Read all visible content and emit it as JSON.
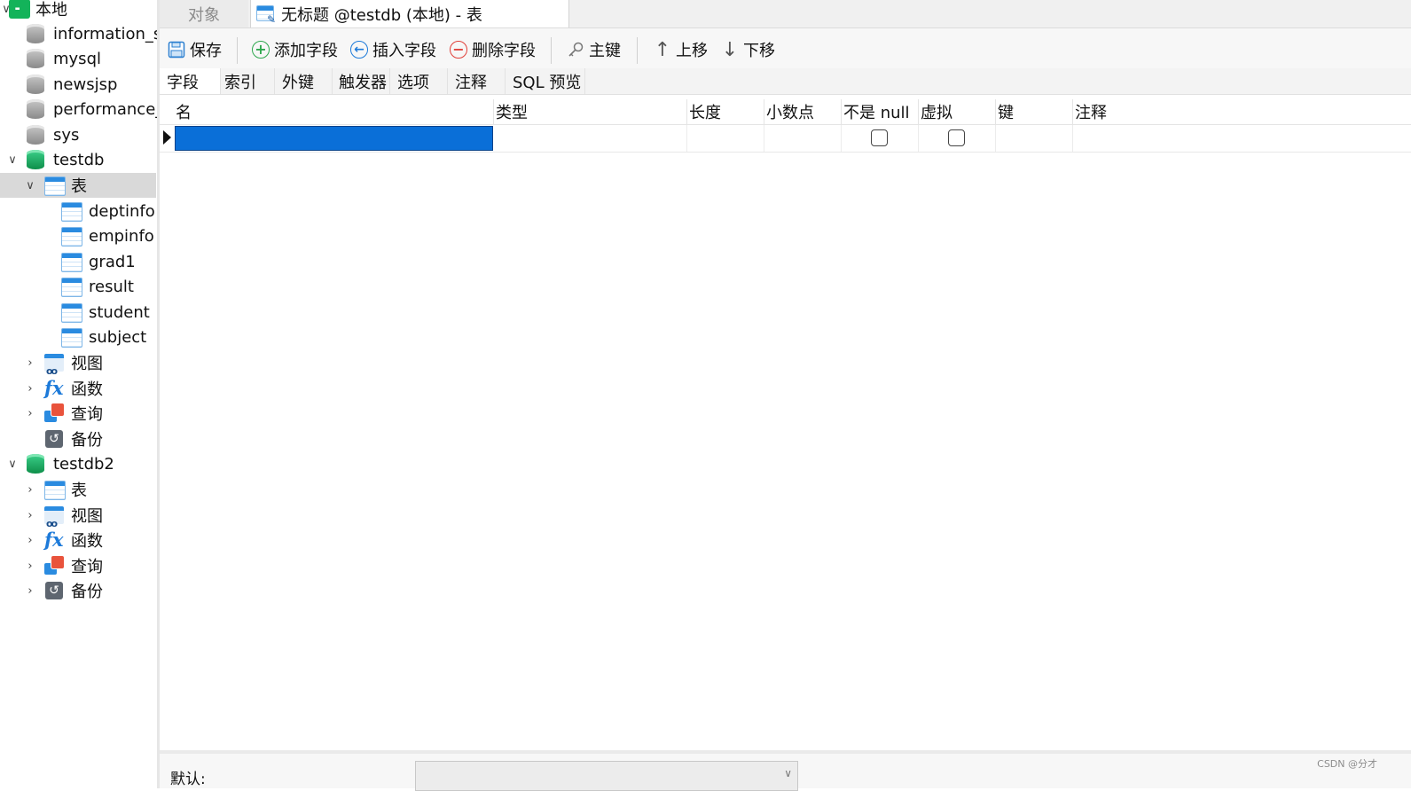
{
  "sidebar": {
    "items": [
      {
        "label": "本地",
        "icon": "connection-icon"
      },
      {
        "label": "information_s",
        "icon": "database-icon"
      },
      {
        "label": "mysql",
        "icon": "database-icon"
      },
      {
        "label": "newsjsp",
        "icon": "database-icon"
      },
      {
        "label": "performance_",
        "icon": "database-icon"
      },
      {
        "label": "sys",
        "icon": "database-icon"
      },
      {
        "label": "testdb",
        "icon": "database-open-icon"
      },
      {
        "label": "表",
        "icon": "table-folder-icon"
      },
      {
        "label": "deptinfo",
        "icon": "table-icon"
      },
      {
        "label": "empinfo",
        "icon": "table-icon"
      },
      {
        "label": "grad1",
        "icon": "table-icon"
      },
      {
        "label": "result",
        "icon": "table-icon"
      },
      {
        "label": "student",
        "icon": "table-icon"
      },
      {
        "label": "subject",
        "icon": "table-icon"
      },
      {
        "label": "视图",
        "icon": "view-icon"
      },
      {
        "label": "函数",
        "icon": "function-icon"
      },
      {
        "label": "查询",
        "icon": "query-icon"
      },
      {
        "label": "备份",
        "icon": "backup-icon"
      },
      {
        "label": "testdb2",
        "icon": "database-open-icon"
      },
      {
        "label": "表",
        "icon": "table-folder-icon"
      },
      {
        "label": "视图",
        "icon": "view-icon"
      },
      {
        "label": "函数",
        "icon": "function-icon"
      },
      {
        "label": "查询",
        "icon": "query-icon"
      },
      {
        "label": "备份",
        "icon": "backup-icon"
      }
    ]
  },
  "tabs": {
    "objects": "对象",
    "active": "无标题 @testdb (本地) - 表"
  },
  "toolbar": {
    "save": "保存",
    "add_field": "添加字段",
    "insert_field": "插入字段",
    "delete_field": "删除字段",
    "primary_key": "主键",
    "move_up": "上移",
    "move_down": "下移"
  },
  "subtabs": [
    "字段",
    "索引",
    "外键",
    "触发器",
    "选项",
    "注释",
    "SQL 预览"
  ],
  "grid": {
    "columns": [
      "名",
      "类型",
      "长度",
      "小数点",
      "不是 null",
      "虚拟",
      "键",
      "注释"
    ],
    "rows": [
      {
        "name": "",
        "type": "",
        "length": "",
        "decimals": "",
        "not_null": false,
        "virtual": false,
        "key": "",
        "comment": ""
      }
    ]
  },
  "bottom": {
    "default_label": "默认:",
    "default_value": ""
  },
  "watermark": "CSDN @分才",
  "colors": {
    "selection": "#0a6fd8",
    "db_green": "#13b35a",
    "table_blue": "#2a8be0"
  }
}
